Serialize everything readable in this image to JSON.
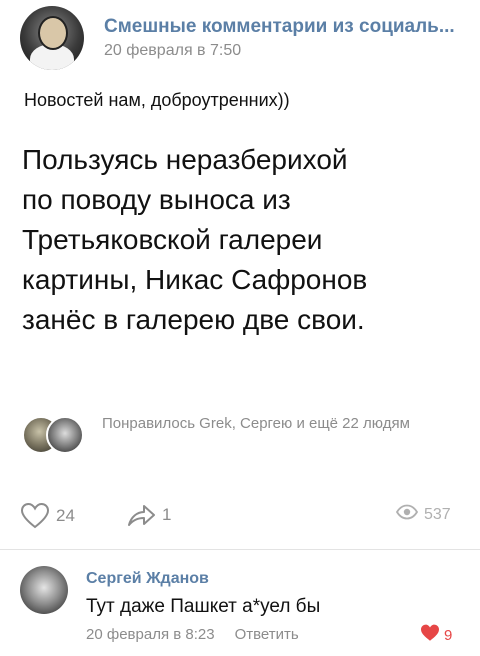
{
  "post": {
    "community_name": "Смешные комментарии из социаль...",
    "time": "20 февраля в 7:50",
    "caption": "Новостей нам, доброутренних))",
    "body_lines": [
      "Пользуясь неразберихой",
      "по поводу выноса из",
      "Третьяковской галереи",
      "картины, Никас Сафронов",
      "занёс в галерею две свои."
    ],
    "likers_text": "Понравилось Grek, Сергею и ещё 22 людям",
    "actions": {
      "likes": "24",
      "shares": "1",
      "views": "537"
    }
  },
  "comment": {
    "author": "Сергей Жданов",
    "text": "Тут даже Пашкет а*уел бы",
    "time": "20 февраля в 8:23",
    "reply_label": "Ответить",
    "likes": "9"
  },
  "colors": {
    "link": "#5b7fa6",
    "muted": "#8c8c8c",
    "like_active": "#e64646"
  },
  "icons": [
    "heart-outline-icon",
    "share-icon",
    "eye-icon",
    "heart-filled-icon"
  ]
}
